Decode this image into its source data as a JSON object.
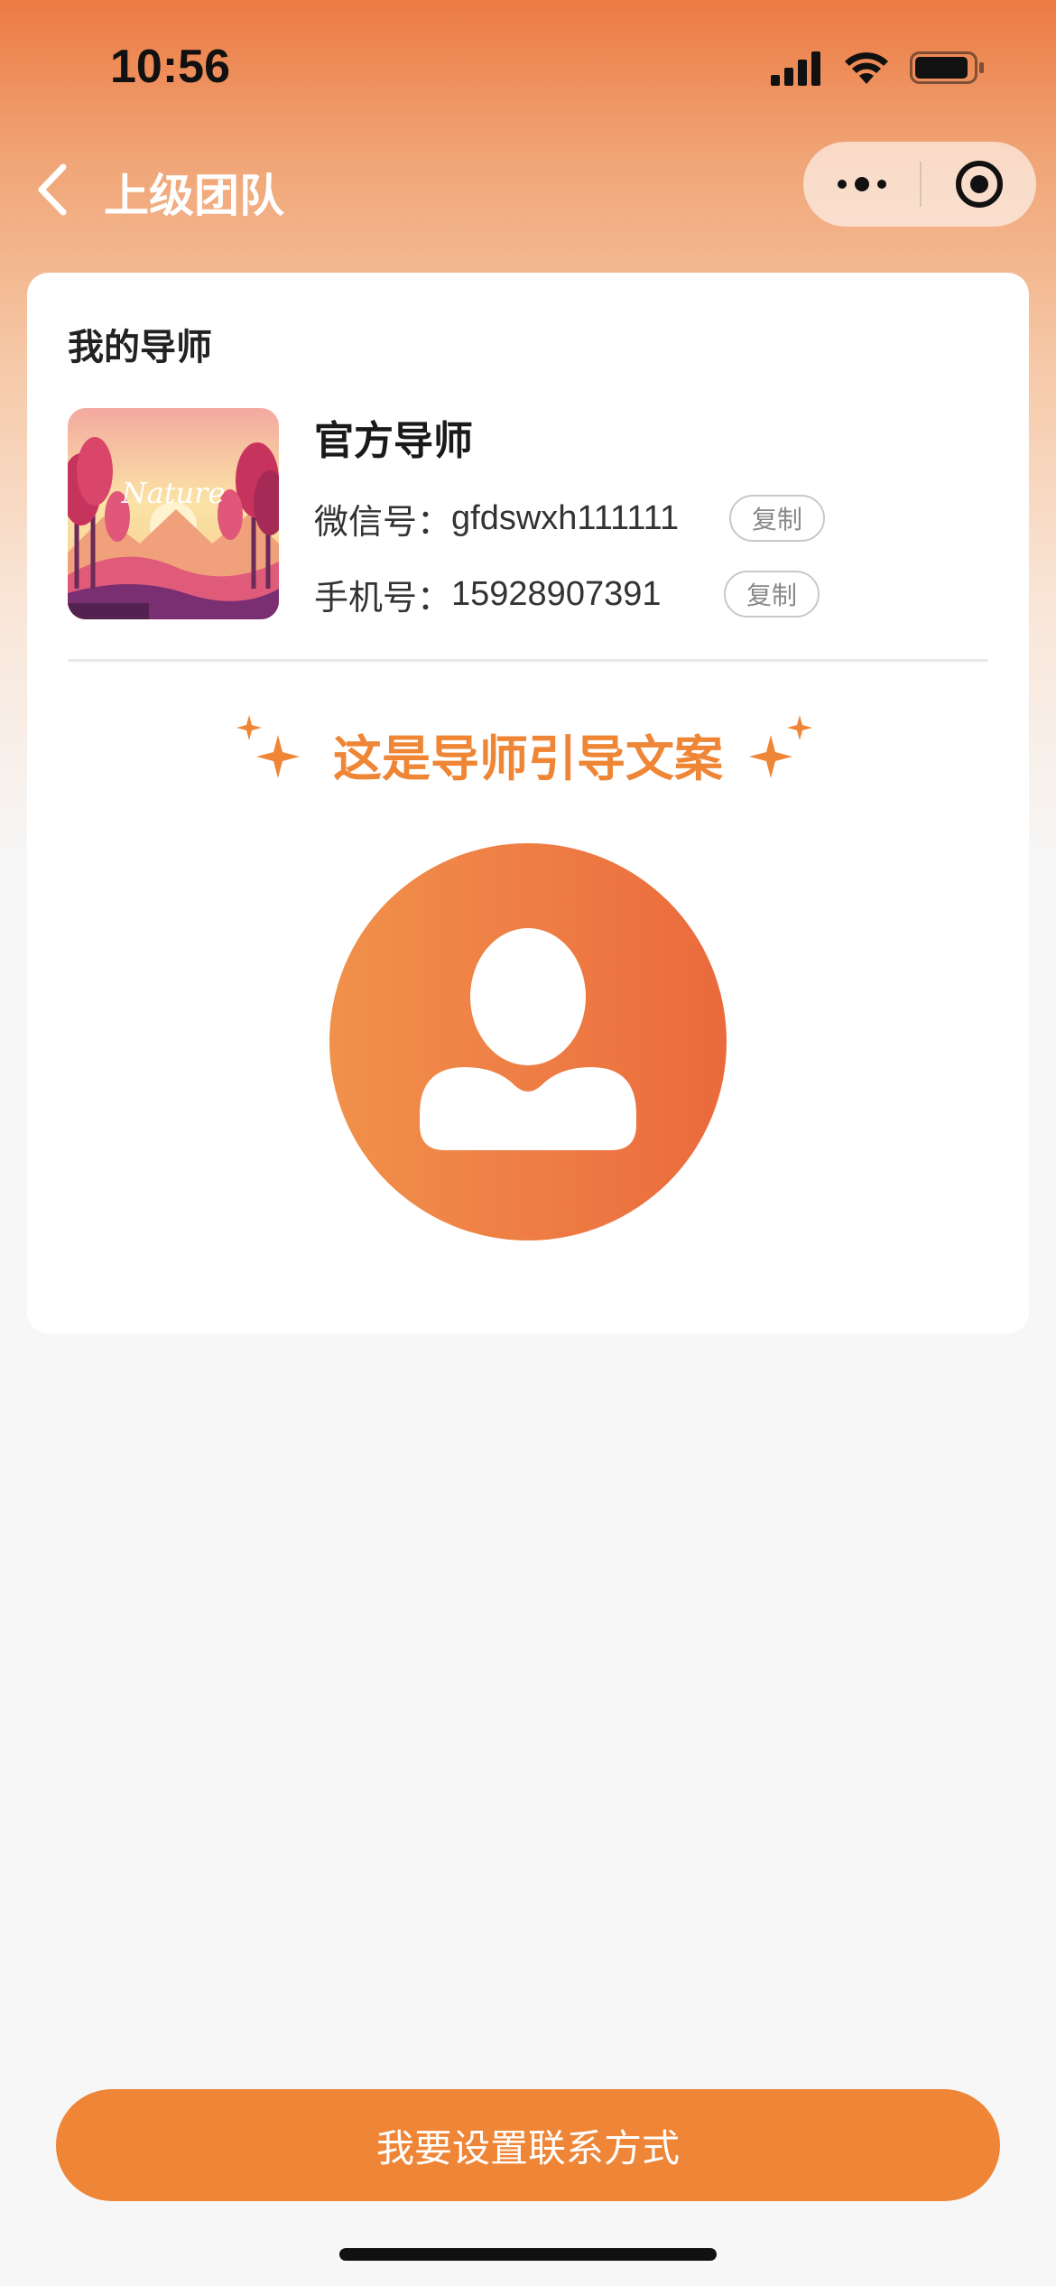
{
  "status_bar": {
    "time": "10:56"
  },
  "nav": {
    "title": "上级团队"
  },
  "card": {
    "section_title": "我的导师",
    "mentor": {
      "name": "官方导师",
      "wechat_label": "微信号：",
      "wechat_value": "gfdswxh111111",
      "phone_label": "手机号：",
      "phone_value": "15928907391",
      "copy_label": "复制",
      "avatar_image_text": "Nature"
    },
    "guide_text": "这是导师引导文案"
  },
  "footer": {
    "button_label": "我要设置联系方式"
  },
  "colors": {
    "accent": "#ef8537",
    "guide_text": "#ee8636",
    "header_gradient_top": "#ec7a43"
  }
}
